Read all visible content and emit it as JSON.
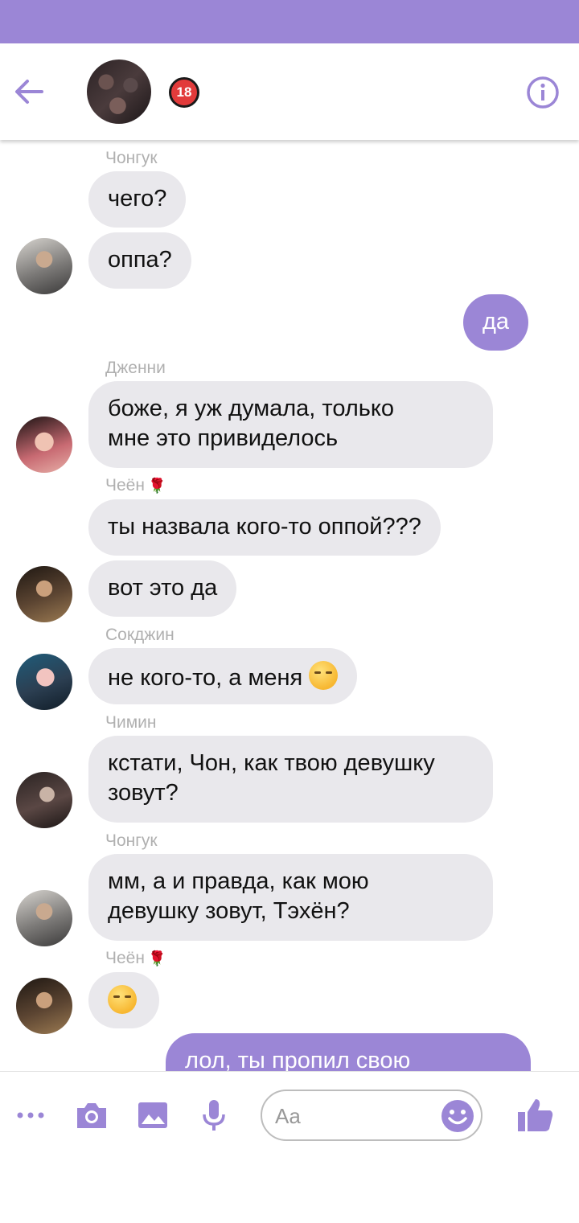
{
  "header": {
    "badge": "18",
    "icons": [
      "back-arrow-icon",
      "info-icon"
    ]
  },
  "messages": [
    {
      "sender": "Чонгук",
      "text": "чего?"
    },
    {
      "text": "оппа?"
    },
    {
      "text": "да",
      "mine": true
    },
    {
      "sender": "Дженни",
      "lines": [
        "боже, я уж думала, только",
        "мне это привиделось"
      ]
    },
    {
      "sender": "Чеён",
      "sender_emoji": "🌹",
      "text": "ты назвала кого-то оппой???"
    },
    {
      "text": "вот это да"
    },
    {
      "sender": "Сокджин",
      "text": "не кого-то, а меня",
      "emoji": "smirk"
    },
    {
      "sender": "Чимин",
      "lines": [
        "кстати, Чон, как твою девушку",
        "зовут?"
      ]
    },
    {
      "sender": "Чонгук",
      "lines": [
        "мм, а и правда, как мою",
        "девушку зовут, Тэхён?"
      ]
    },
    {
      "sender": "Чеён",
      "sender_emoji": "🌹",
      "emoji": "confused"
    },
    {
      "text": "лол, ты пропил свою",
      "mine": true
    }
  ],
  "composer": {
    "placeholder": "Aa",
    "icons": [
      "more-icon",
      "camera-icon",
      "image-icon",
      "microphone-icon",
      "emoji-icon",
      "thumbs-up-icon"
    ]
  },
  "colors": {
    "accent": "#9b86d6",
    "incoming_bubble": "#e9e8ec",
    "sender_name": "#b0b0b0"
  }
}
